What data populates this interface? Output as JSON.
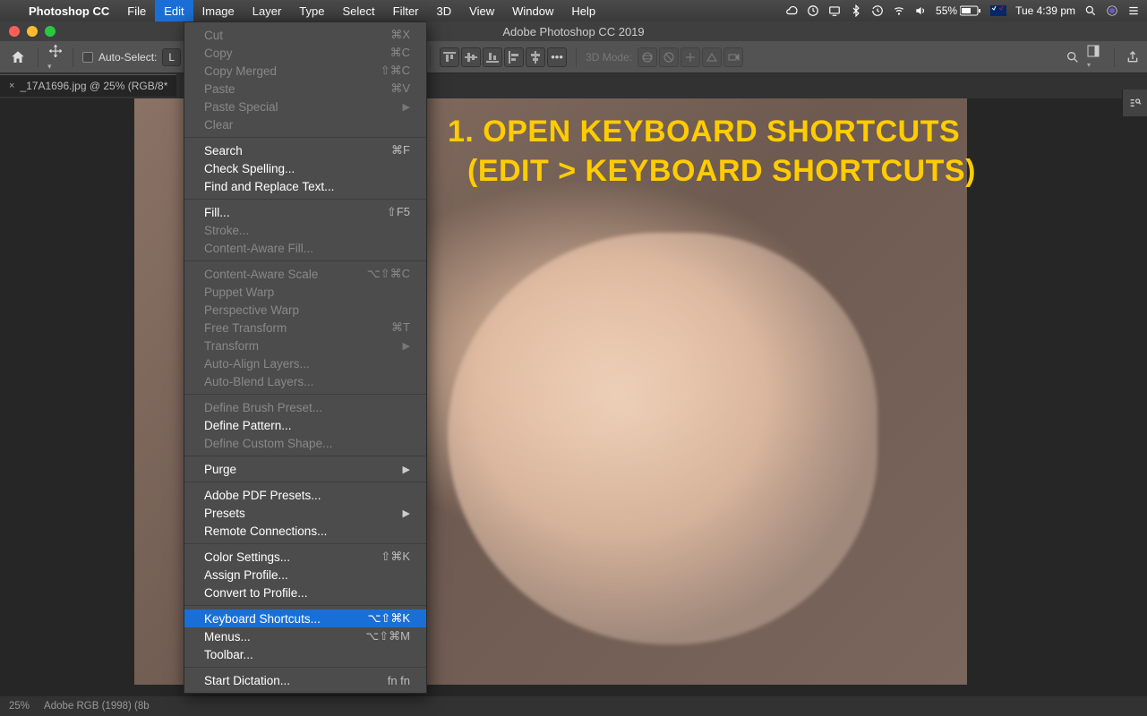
{
  "mac_menu": {
    "app_name": "Photoshop CC",
    "items": [
      "File",
      "Edit",
      "Image",
      "Layer",
      "Type",
      "Select",
      "Filter",
      "3D",
      "View",
      "Window",
      "Help"
    ],
    "active_index": 1,
    "status": {
      "battery": "55%",
      "clock": "Tue 4:39 pm"
    }
  },
  "window": {
    "title": "Adobe Photoshop CC 2019"
  },
  "options_bar": {
    "auto_select_label": "Auto-Select:",
    "layer_label": "L",
    "threed_label": "3D Mode:"
  },
  "doc_tab": {
    "label": "_17A1696.jpg @ 25% (RGB/8*"
  },
  "annotation": {
    "line1": "1. OPEN KEYBOARD SHORTCUTS",
    "line2": "(EDIT > KEYBOARD SHORTCUTS)"
  },
  "edit_menu": [
    {
      "label": "Cut",
      "shortcut": "⌘X",
      "disabled": true
    },
    {
      "label": "Copy",
      "shortcut": "⌘C",
      "disabled": true
    },
    {
      "label": "Copy Merged",
      "shortcut": "⇧⌘C",
      "disabled": true
    },
    {
      "label": "Paste",
      "shortcut": "⌘V",
      "disabled": true
    },
    {
      "label": "Paste Special",
      "submenu": true,
      "disabled": true
    },
    {
      "label": "Clear",
      "disabled": true
    },
    {
      "divider": true
    },
    {
      "label": "Search",
      "shortcut": "⌘F"
    },
    {
      "label": "Check Spelling..."
    },
    {
      "label": "Find and Replace Text..."
    },
    {
      "divider": true
    },
    {
      "label": "Fill...",
      "shortcut": "⇧F5"
    },
    {
      "label": "Stroke...",
      "disabled": true
    },
    {
      "label": "Content-Aware Fill...",
      "disabled": true
    },
    {
      "divider": true
    },
    {
      "label": "Content-Aware Scale",
      "shortcut": "⌥⇧⌘C",
      "disabled": true
    },
    {
      "label": "Puppet Warp",
      "disabled": true
    },
    {
      "label": "Perspective Warp",
      "disabled": true
    },
    {
      "label": "Free Transform",
      "shortcut": "⌘T",
      "disabled": true
    },
    {
      "label": "Transform",
      "submenu": true,
      "disabled": true
    },
    {
      "label": "Auto-Align Layers...",
      "disabled": true
    },
    {
      "label": "Auto-Blend Layers...",
      "disabled": true
    },
    {
      "divider": true
    },
    {
      "label": "Define Brush Preset...",
      "disabled": true
    },
    {
      "label": "Define Pattern..."
    },
    {
      "label": "Define Custom Shape...",
      "disabled": true
    },
    {
      "divider": true
    },
    {
      "label": "Purge",
      "submenu": true
    },
    {
      "divider": true
    },
    {
      "label": "Adobe PDF Presets..."
    },
    {
      "label": "Presets",
      "submenu": true
    },
    {
      "label": "Remote Connections..."
    },
    {
      "divider": true
    },
    {
      "label": "Color Settings...",
      "shortcut": "⇧⌘K"
    },
    {
      "label": "Assign Profile..."
    },
    {
      "label": "Convert to Profile..."
    },
    {
      "divider": true
    },
    {
      "label": "Keyboard Shortcuts...",
      "shortcut": "⌥⇧⌘K",
      "highlight": true
    },
    {
      "label": "Menus...",
      "shortcut": "⌥⇧⌘M"
    },
    {
      "label": "Toolbar..."
    },
    {
      "divider": true
    },
    {
      "label": "Start Dictation...",
      "shortcut": "fn fn"
    }
  ],
  "statusbar": {
    "zoom": "25%",
    "profile": "Adobe RGB (1998) (8b"
  }
}
